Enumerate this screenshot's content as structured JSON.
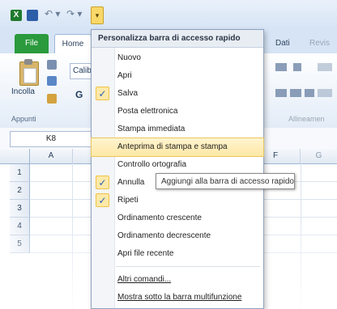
{
  "qat": {
    "excel_glyph": "X",
    "undo_glyph": "↶ ▾",
    "redo_glyph": "↷ ▾",
    "customize_glyph": "▾",
    "icons": [
      "excel-app-icon",
      "save-icon",
      "undo-icon",
      "redo-icon",
      "customize-dropdown-icon"
    ]
  },
  "tabs": {
    "file": "File",
    "home": "Home",
    "dati": "Dati",
    "revisione": "Revis"
  },
  "ribbon": {
    "paste_label": "Incolla",
    "font_name": "Calib",
    "bold": "G",
    "clipboard_group": "Appunti",
    "alignment_group": "Allineamen"
  },
  "formula_bar": {
    "name_box": "K8"
  },
  "grid": {
    "columns": [
      "A",
      "F",
      "G"
    ],
    "rows": [
      "1",
      "2",
      "3",
      "4",
      "5"
    ]
  },
  "menu": {
    "title": "Personalizza barra di accesso rapido",
    "items": [
      {
        "label": "Nuovo",
        "checked": false
      },
      {
        "label": "Apri",
        "checked": false
      },
      {
        "label": "Salva",
        "checked": true
      },
      {
        "label": "Posta elettronica",
        "checked": false
      },
      {
        "label": "Stampa immediata",
        "checked": false
      },
      {
        "label": "Anteprima di stampa e stampa",
        "checked": false,
        "highlighted": true
      },
      {
        "label": "Controllo ortografia",
        "checked": false
      },
      {
        "label": "Annulla",
        "checked": true
      },
      {
        "label": "Ripeti",
        "checked": true
      },
      {
        "label": "Ordinamento crescente",
        "checked": false
      },
      {
        "label": "Ordinamento decrescente",
        "checked": false
      },
      {
        "label": "Apri file recente",
        "checked": false
      }
    ],
    "more_commands": "Altri comandi...",
    "show_below": "Mostra sotto la barra multifunzione",
    "check_glyph": "✓"
  },
  "tooltip": {
    "text": "Aggiungi alla barra di accesso rapido"
  },
  "colors": {
    "highlight": "#ffe8a6",
    "file_tab": "#2a9a3c",
    "check": "#2a5fb5"
  }
}
